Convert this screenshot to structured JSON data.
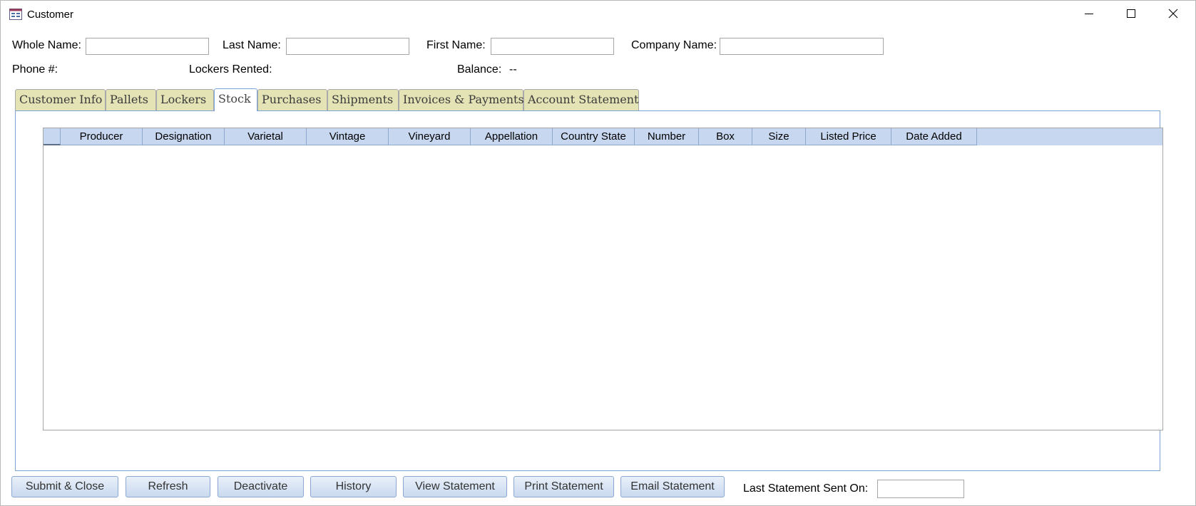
{
  "window": {
    "title": "Customer",
    "controls": {
      "minimize": "minimize",
      "maximize": "maximize",
      "close": "close"
    }
  },
  "form": {
    "whole_name": {
      "label": "Whole Name:",
      "value": ""
    },
    "last_name": {
      "label": "Last Name:",
      "value": ""
    },
    "first_name": {
      "label": "First Name:",
      "value": ""
    },
    "company_name": {
      "label": "Company Name:",
      "value": ""
    },
    "phone": {
      "label": "Phone #:",
      "value": ""
    },
    "lockers_rented": {
      "label": "Lockers Rented:",
      "value": ""
    },
    "balance": {
      "label": "Balance:",
      "value": "--"
    }
  },
  "tabs": [
    {
      "label": "Customer Info",
      "active": false
    },
    {
      "label": "Pallets",
      "active": false
    },
    {
      "label": "Lockers",
      "active": false
    },
    {
      "label": "Stock",
      "active": true
    },
    {
      "label": "Purchases",
      "active": false
    },
    {
      "label": "Shipments",
      "active": false
    },
    {
      "label": "Invoices & Payments",
      "active": false
    },
    {
      "label": "Account Statement",
      "active": false
    }
  ],
  "stock_table": {
    "columns": [
      "Producer",
      "Designation",
      "Varietal",
      "Vintage",
      "Vineyard",
      "Appellation",
      "Country State",
      "Number",
      "Box",
      "Size",
      "Listed Price",
      "Date Added"
    ],
    "rows": []
  },
  "buttons": {
    "submit_close": "Submit & Close",
    "refresh": "Refresh",
    "deactivate": "Deactivate",
    "history": "History",
    "view_statement": "View Statement",
    "print_statement": "Print Statement",
    "email_statement": "Email Statement"
  },
  "last_statement": {
    "label": "Last Statement Sent On:",
    "value": ""
  },
  "colors": {
    "tab_inactive": "#e3e3b6",
    "tab_active_border": "#7ea6d4",
    "header_bg": "#c7d7ef",
    "button_bg": "#cad9ef"
  },
  "icons": {
    "app": "form-icon",
    "minimize": "minimize-icon",
    "maximize": "maximize-icon",
    "close": "close-icon"
  }
}
